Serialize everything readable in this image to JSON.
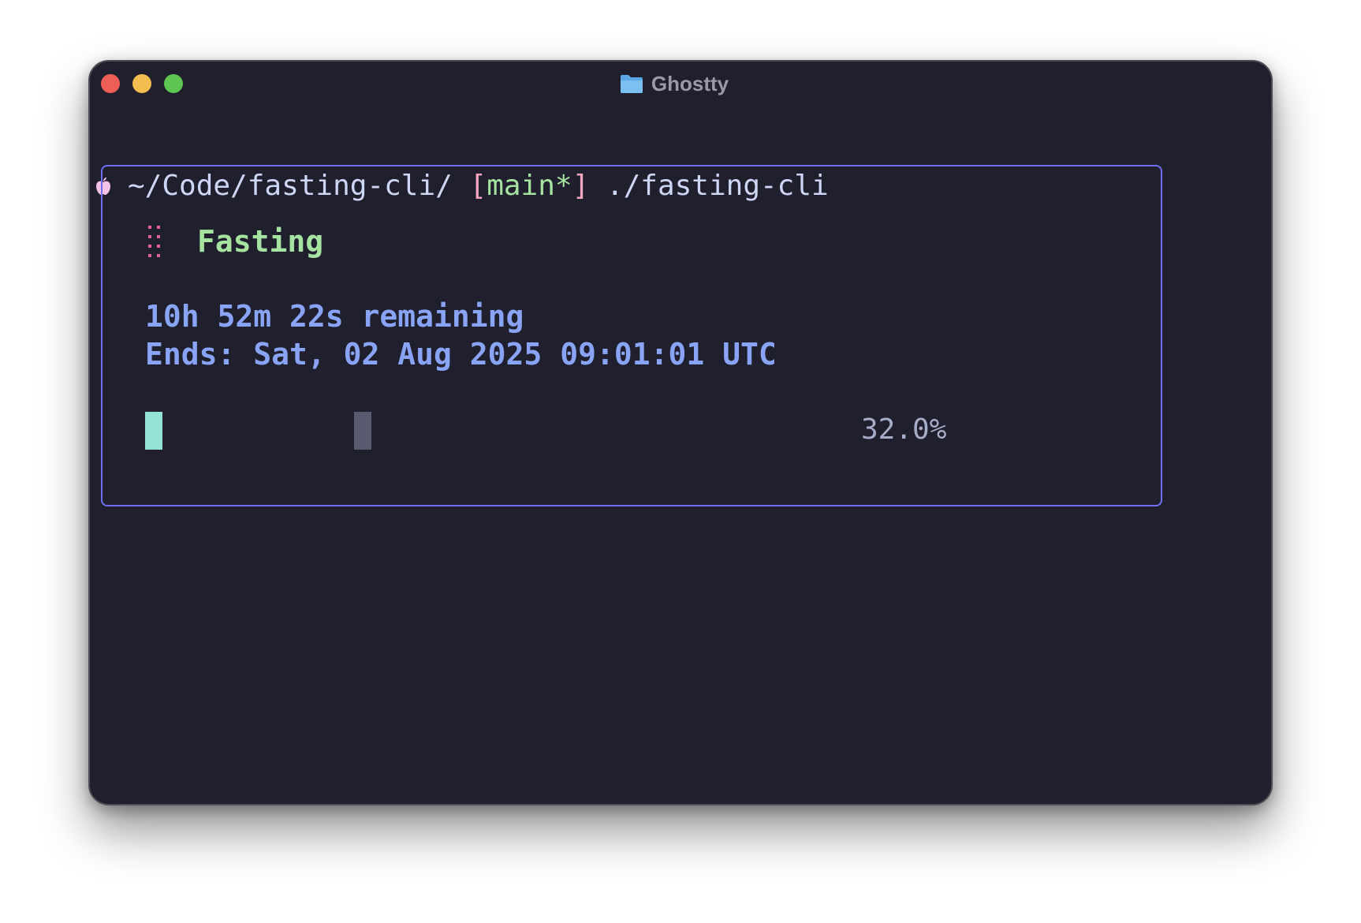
{
  "window": {
    "title": "Ghostty",
    "title_icon": "folder-icon"
  },
  "prompt": {
    "icon": "apple-icon",
    "path": "~/Code/fasting-cli/",
    "bracket_open": "[",
    "branch": "main*",
    "bracket_close": "]",
    "command": "./fasting-cli"
  },
  "tui": {
    "spinner_icon": "braille-spinner-icon",
    "heading": "Fasting",
    "remaining": "10h 52m 22s remaining",
    "ends": "Ends: Sat, 02 Aug 2025 09:01:01 UTC",
    "progress": 0.32,
    "progress_label": "32.0%"
  },
  "colors": {
    "background": "#1f1f2d",
    "box_border": "#6f6ef3",
    "heading": "#a6e3a1",
    "info_text": "#89a4f5",
    "bar_fill": "#94e2d5",
    "bar_track": "#585b70",
    "branch": "#a6e3a1",
    "bracket": "#f5a6c1",
    "spinner": "#e05fa3"
  }
}
